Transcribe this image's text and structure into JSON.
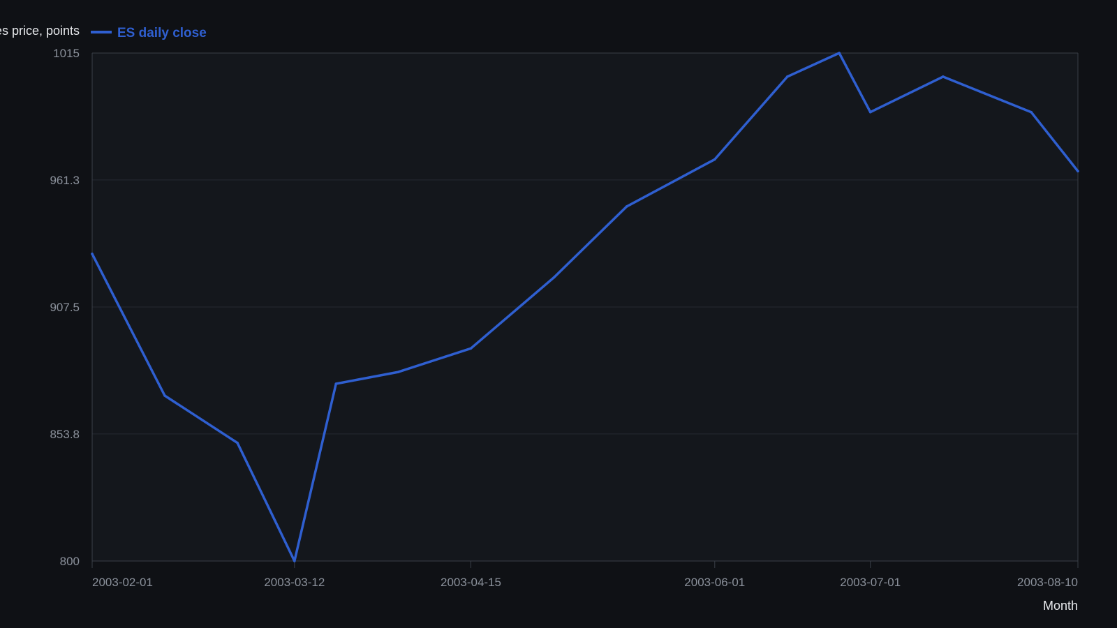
{
  "colors": {
    "background": "#0f1115",
    "plot_background": "#14171c",
    "grid": "#262a31",
    "axis": "#3a3f48",
    "series": "#2f5fd0",
    "tick_text": "#8b919b",
    "title_text": "#e6e8eb"
  },
  "chart_data": {
    "type": "line",
    "xlabel": "Month",
    "ylabel": "Futures price, points",
    "x_type": "date",
    "xlim": [
      "2003-02-01",
      "2003-08-10"
    ],
    "ylim": [
      800,
      1015
    ],
    "y_ticks": [
      "800",
      "853.8",
      "907.5",
      "961.3",
      "1015"
    ],
    "x_ticks": [
      "2003-02-01",
      "2003-03-12",
      "2003-04-15",
      "2003-06-01",
      "2003-07-01",
      "2003-08-10"
    ],
    "grid": true,
    "legend": "top-left",
    "series": [
      {
        "name": "ES daily close",
        "color": "#2f5fd0",
        "x": [
          "2003-02-01",
          "2003-02-15",
          "2003-03-01",
          "2003-03-12",
          "2003-03-20",
          "2003-04-01",
          "2003-04-15",
          "2003-05-01",
          "2003-05-15",
          "2003-06-01",
          "2003-06-15",
          "2003-06-25",
          "2003-07-01",
          "2003-07-15",
          "2003-08-01",
          "2003-08-10"
        ],
        "y": [
          930,
          870,
          850,
          800,
          875,
          880,
          890,
          920,
          950,
          970,
          1005,
          1015,
          990,
          1005,
          990,
          965
        ]
      }
    ]
  }
}
